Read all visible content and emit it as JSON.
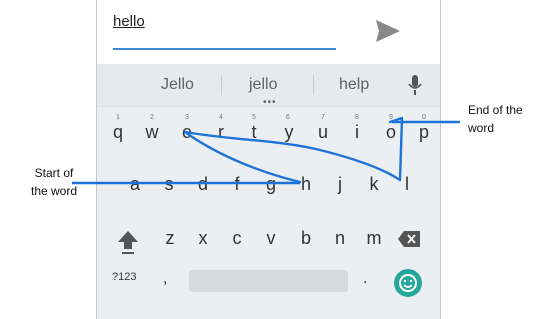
{
  "input": {
    "text": "hello"
  },
  "suggestions": [
    "Jello",
    "jello",
    "help"
  ],
  "suggestion_more": "•••",
  "rows": {
    "top": [
      "q",
      "w",
      "e",
      "r",
      "t",
      "y",
      "u",
      "i",
      "o",
      "p"
    ],
    "numbers": [
      "1",
      "2",
      "3",
      "4",
      "5",
      "6",
      "7",
      "8",
      "9",
      "0"
    ],
    "middle": [
      "a",
      "s",
      "d",
      "f",
      "g",
      "h",
      "j",
      "k",
      "l"
    ],
    "bottom": [
      "z",
      "x",
      "c",
      "v",
      "b",
      "n",
      "m"
    ]
  },
  "bottom_row": {
    "symbols": "?123",
    "comma": ",",
    "period": "."
  },
  "annotations": {
    "start": "Start of\nthe word",
    "end": "End of the\nword"
  },
  "colors": {
    "accent": "#3b8ad6",
    "emoji": "#26a69a",
    "swipe": "#1e73d8"
  },
  "icons": [
    "send-icon",
    "mic-icon",
    "shift-icon",
    "backspace-icon",
    "emoji-icon"
  ]
}
